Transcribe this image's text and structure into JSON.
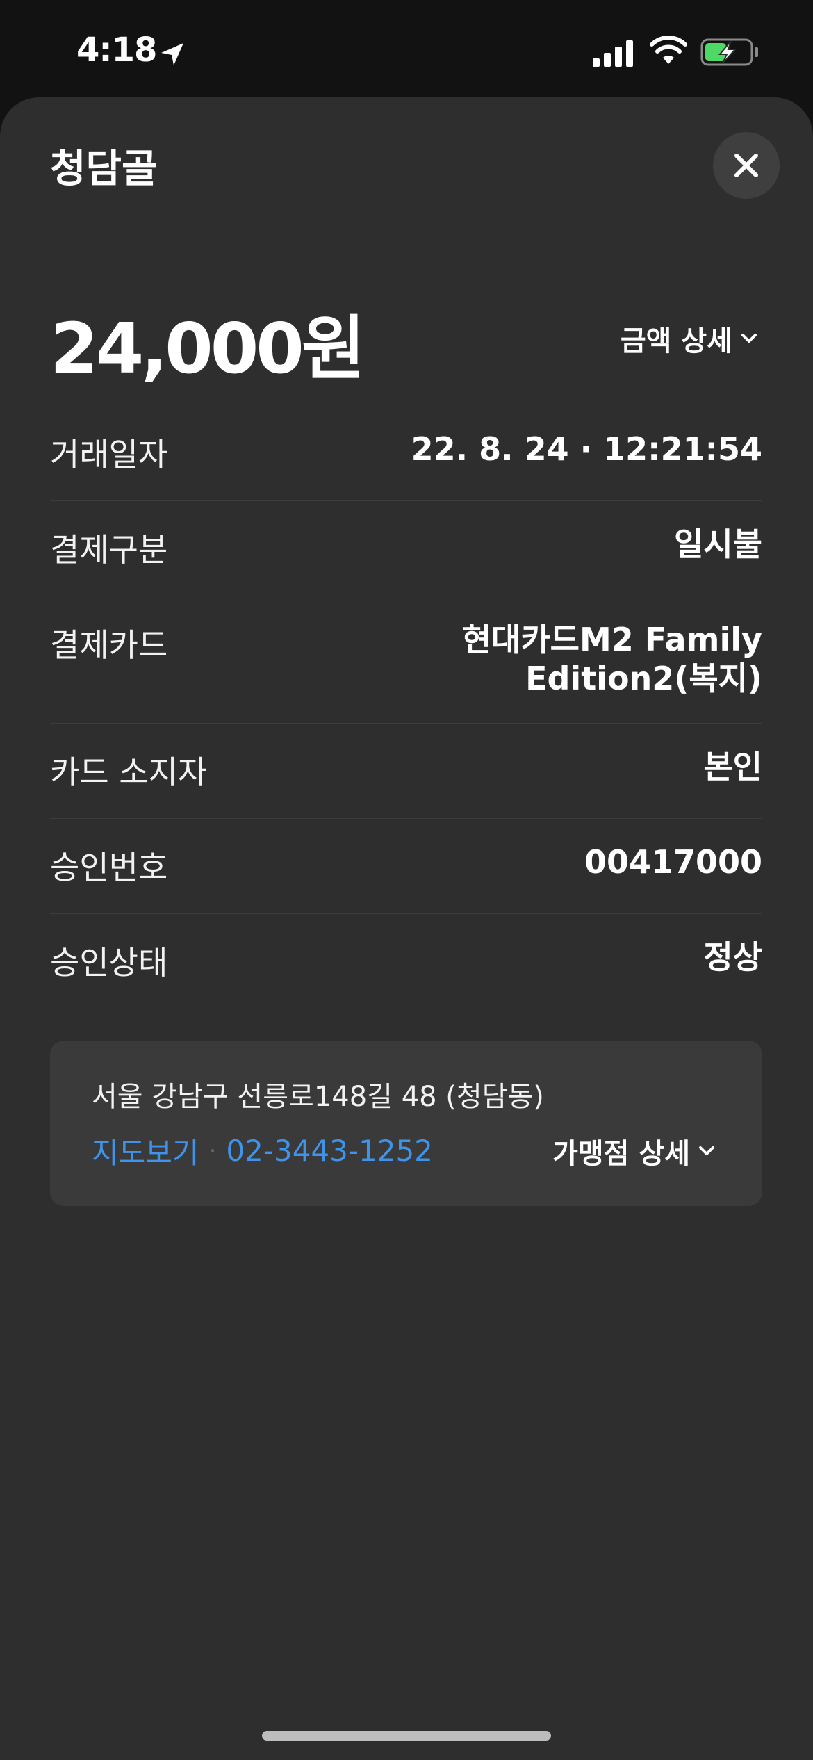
{
  "status_bar": {
    "time": "4:18"
  },
  "sheet": {
    "title": "청담골",
    "amount": "24,000원",
    "amount_detail_label": "금액 상세"
  },
  "details": [
    {
      "label": "거래일자",
      "value": "22. 8. 24 · 12:21:54"
    },
    {
      "label": "결제구분",
      "value": "일시불"
    },
    {
      "label": "결제카드",
      "value": "현대카드M2 Family Edition2(복지)"
    },
    {
      "label": "카드 소지자",
      "value": "본인"
    },
    {
      "label": "승인번호",
      "value": "00417000"
    },
    {
      "label": "승인상태",
      "value": "정상"
    }
  ],
  "merchant": {
    "address": "서울 강남구 선릉로148길 48 (청담동)",
    "map_link": "지도보기",
    "phone": "02-3443-1252",
    "detail_label": "가맹점 상세"
  },
  "colors": {
    "link": "#3f94ea",
    "sheet_bg": "#2e2e2e",
    "battery_fill": "#4cd964"
  },
  "icons": [
    "location-arrow-icon",
    "cellular-signal-icon",
    "wifi-icon",
    "battery-charging-icon",
    "close-icon",
    "chevron-down-icon"
  ]
}
